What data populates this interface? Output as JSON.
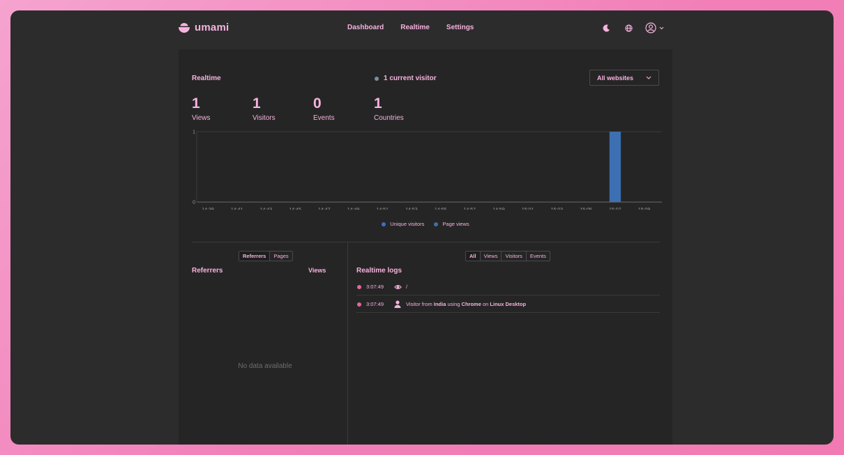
{
  "app": {
    "name": "umami"
  },
  "nav": {
    "items": [
      "Dashboard",
      "Realtime",
      "Settings"
    ]
  },
  "header_icons": [
    "moon-icon",
    "globe-icon",
    "user-circle-icon",
    "chevron-down-icon"
  ],
  "realtime": {
    "title": "Realtime",
    "current_visitor": "1 current visitor",
    "website_select": "All websites",
    "metrics": [
      {
        "value": "1",
        "label": "Views"
      },
      {
        "value": "1",
        "label": "Visitors"
      },
      {
        "value": "0",
        "label": "Events"
      },
      {
        "value": "1",
        "label": "Countries"
      }
    ]
  },
  "chart_data": {
    "type": "bar",
    "categories": [
      "14:39",
      "14:41",
      "14:43",
      "14:45",
      "14:47",
      "14:49",
      "14:51",
      "14:53",
      "14:55",
      "14:57",
      "14:59",
      "15:01",
      "15:03",
      "15:05",
      "15:07",
      "15:09"
    ],
    "ylim": [
      0,
      1
    ],
    "y_ticks": [
      "0",
      "1"
    ],
    "series": [
      {
        "name": "Unique visitors",
        "color": "#3a71c1",
        "bars": [
          {
            "x": "15:07",
            "value": 1
          }
        ]
      },
      {
        "name": "Page views",
        "color": "#3f6fa8",
        "bars": [
          {
            "x": "15:07",
            "value": 1
          }
        ]
      }
    ],
    "legend_position": "bottom"
  },
  "referrers": {
    "tabs": [
      "Referrers",
      "Pages"
    ],
    "active_tab": "Referrers",
    "title": "Referrers",
    "column": "Views",
    "empty_text": "No data available"
  },
  "logs": {
    "filters": [
      "All",
      "Views",
      "Visitors",
      "Events"
    ],
    "active_filter": "All",
    "title": "Realtime logs",
    "rows": [
      {
        "time": "3:07:49",
        "icon": "eye-icon",
        "text": "/"
      },
      {
        "time": "3:07:49",
        "icon": "user-icon",
        "prefix": "Visitor from",
        "country": "India",
        "using": "using",
        "browser": "Chrome",
        "on": "on",
        "os": "Linux Desktop"
      }
    ]
  },
  "colors": {
    "accent": "#f7b3de",
    "bar": "#3a71c1",
    "background": "#2c2c2c",
    "panel": "#252525"
  }
}
